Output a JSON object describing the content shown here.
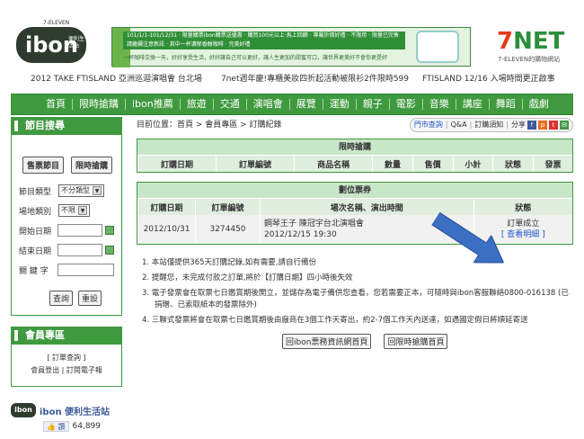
{
  "header": {
    "logo_text": "ibon",
    "logo_sub": "便利生活站",
    "logo_brand_top": "7-ELEVEN",
    "banner_headline": "101/1/1-101/12/31 · 限量購票ibon購票送優惠 · 購買100元以上·馬上回饋 · 專屬折價好禮 · 不限用 · 限量已完售請繼續注意新訊 · 其中一杯濃郁香醇咖啡 · 完美好禮",
    "banner_sub": "一杯咖啡交換一天，好好享受生活，好好讓自己可以更好，讓人生更加的甜蜜可口，讓世界更美好不會你更是好",
    "seven_net": "7NET",
    "seven_net_sub": "7-ELEVEN的購物網站"
  },
  "ticker": [
    "2012 TAKE FTISLAND 亞洲巡迴演唱會 台北場",
    "7net週年慶!專櫃美妝四折起活動被限衫2件限時599",
    "FTISLAND 12/16 入場時間更正啟事"
  ],
  "nav": [
    "首頁",
    "限時搶購",
    "ibon推薦",
    "旅遊",
    "交通",
    "演唱會",
    "展覽",
    "運動",
    "親子",
    "電影",
    "音樂",
    "講座",
    "舞蹈",
    "戲劇"
  ],
  "sidebar": {
    "search_title": "節目搜尋",
    "tab_ticket": "售票節目",
    "tab_rush": "限時搶購",
    "fields": [
      {
        "label": "節目類型",
        "value": "不分類型"
      },
      {
        "label": "場地類別",
        "value": "不限"
      },
      {
        "label": "開始日期",
        "value": ""
      },
      {
        "label": "結束日期",
        "value": ""
      },
      {
        "label": "關 鍵 字",
        "value": ""
      }
    ],
    "query_btn": "查詢",
    "reset_btn": "重設",
    "member_title": "會員專區",
    "member_order": "[ 訂單查詢 ]",
    "member_logout": "會員登出",
    "member_epaper": "訂閱電子報",
    "fb_name": "ibon 便利生活站",
    "fb_like": "讚",
    "fb_count": "64,899"
  },
  "main": {
    "breadcrumb": "目前位置：首頁 > 會員專區 > 訂購紀錄",
    "util": [
      "門市查詢",
      "Q&A",
      "訂購須知",
      "分享"
    ],
    "rush": {
      "title": "限時搶購",
      "headers": [
        "訂購日期",
        "訂單編號",
        "商品名稱",
        "數量",
        "售價",
        "小計",
        "狀態",
        "發票"
      ]
    },
    "seat": {
      "title": "劃位票券",
      "headers": [
        "訂購日期",
        "訂單編號",
        "場次名稱、演出時間",
        "狀態"
      ],
      "rows": [
        {
          "date": "2012/10/31",
          "order": "3274450",
          "event": "鋼琴王子 陳冠宇台北演唱會",
          "time": "2012/12/15 19:30",
          "status": "訂單成立",
          "detail": "[ 查看明細 ]"
        }
      ]
    },
    "notes": [
      "1. 本站僅提供365天訂購記錄,如有需要,請自行備份",
      "2. 提醒您，未完成付款之訂單,將於【訂購日期】四小時後失效",
      "3. 電子發票會在取票七日鑑賞期後開立，並儲存為電子備供您查看，您若需要正本，可隨時與ibon客服聯絡0800-016138 (已捐贈、已索取紙本的發票除外)",
      "4. 三聯式發票將會在取票七日鑑賞期後由廠商在3個工作天寄出，約2-7個工作天內送達，如遇國定假日將順延寄送"
    ],
    "btn_home": "回ibon票務資訊網首頁",
    "btn_rush": "回限時搶購首頁"
  },
  "colors": {
    "nav_green": "#3f9a3f",
    "panel_green": "#c8e6c8",
    "header_row": "#dfeedf",
    "link_blue": "#2255cc",
    "arrow_blue": "#3a6fc4"
  }
}
